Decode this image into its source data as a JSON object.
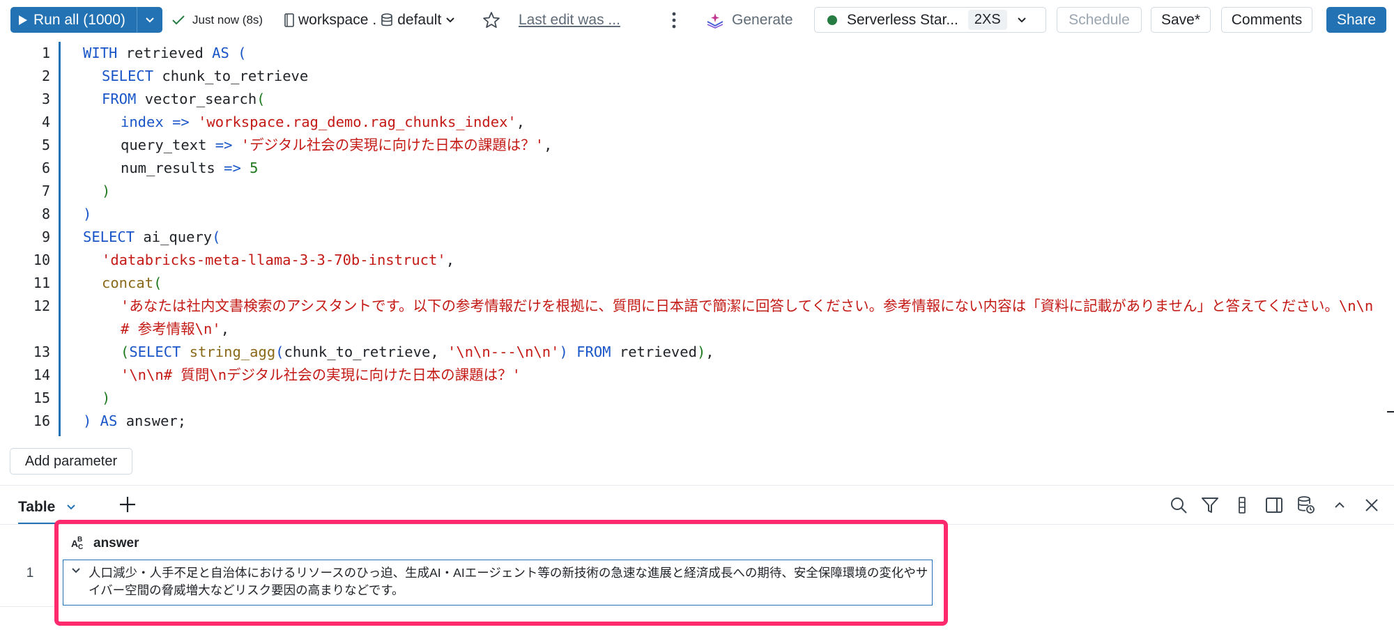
{
  "toolbar": {
    "run_label": "Run all (1000)",
    "status_text": "Just now (8s)",
    "catalog": "workspace",
    "schema": "default",
    "last_edit": "Last edit was ...",
    "generate_label": "Generate",
    "compute_name": "Serverless Star...",
    "compute_size": "2XS",
    "schedule_label": "Schedule",
    "save_label": "Save*",
    "comments_label": "Comments",
    "share_label": "Share"
  },
  "editor": {
    "line_numbers": [
      "1",
      "2",
      "3",
      "4",
      "5",
      "6",
      "7",
      "8",
      "9",
      "10",
      "11",
      "12",
      "13",
      "14",
      "15",
      "16"
    ],
    "lines": {
      "l1": {
        "kw1": "WITH",
        "t1": " retrieved ",
        "kw2": "AS",
        "p1": " ("
      },
      "l2": {
        "kw1": "SELECT",
        "t1": " chunk_to_retrieve"
      },
      "l3": {
        "kw1": "FROM",
        "t1": " vector_search",
        "p1": "("
      },
      "l4": {
        "t1": "index ",
        "op": "=>",
        "s1": " 'workspace.rag_demo.rag_chunks_index'",
        "t2": ","
      },
      "l5": {
        "t1": "query_text ",
        "op": "=>",
        "s1": " 'デジタル社会の実現に向けた日本の課題は？'",
        "t2": ","
      },
      "l6": {
        "t1": "num_results ",
        "op": "=>",
        "n1": " 5"
      },
      "l7": {
        "p1": ")"
      },
      "l8": {
        "p1": ")"
      },
      "l9": {
        "kw1": "SELECT",
        "t1": " ai_query",
        "p1": "("
      },
      "l10": {
        "s1": "'databricks-meta-llama-3-3-70b-instruct'",
        "t1": ","
      },
      "l11": {
        "t1": "concat",
        "p1": "("
      },
      "l12": {
        "s1": "'あなたは社内文書検索のアシスタントです。以下の参考情報だけを根拠に、質問に日本語で簡潔に回答してください。参考情報にない内容は「資料に記載がありません」と答えてください。\\n\\n# 参考情報\\n'",
        "t1": ","
      },
      "l13": {
        "p1": "(",
        "kw1": "SELECT",
        "t1": " string_agg",
        "p2": "(",
        "t2": "chunk_to_retrieve, ",
        "s1": "'\\n\\n---\\n\\n'",
        "p3": ")",
        "kw2": " FROM",
        "t3": " retrieved",
        "p4": ")",
        "t4": ","
      },
      "l14": {
        "s1": "'\\n\\n# 質問\\nデジタル社会の実現に向けた日本の課題は？'"
      },
      "l15": {
        "p1": ")"
      },
      "l16": {
        "p1": ")",
        "kw1": " AS",
        "t1": " answer;"
      }
    }
  },
  "add_parameter_label": "Add parameter",
  "results": {
    "tab_label": "Table",
    "column_header": "answer",
    "rows": [
      {
        "index": "1",
        "answer": "人口減少・人手不足と自治体におけるリソースのひっ迫、生成AI・AIエージェント等の新技術の急速な進展と経済成長への期待、安全保障環境の変化やサイバー空間の脅威増大などリスク要因の高まりなどです。"
      }
    ]
  },
  "colors": {
    "accent": "#2272b4",
    "highlight": "#ff2a6d",
    "keyword": "#1a56c8",
    "string": "#c41a16",
    "paren": "#1f7a1f"
  }
}
